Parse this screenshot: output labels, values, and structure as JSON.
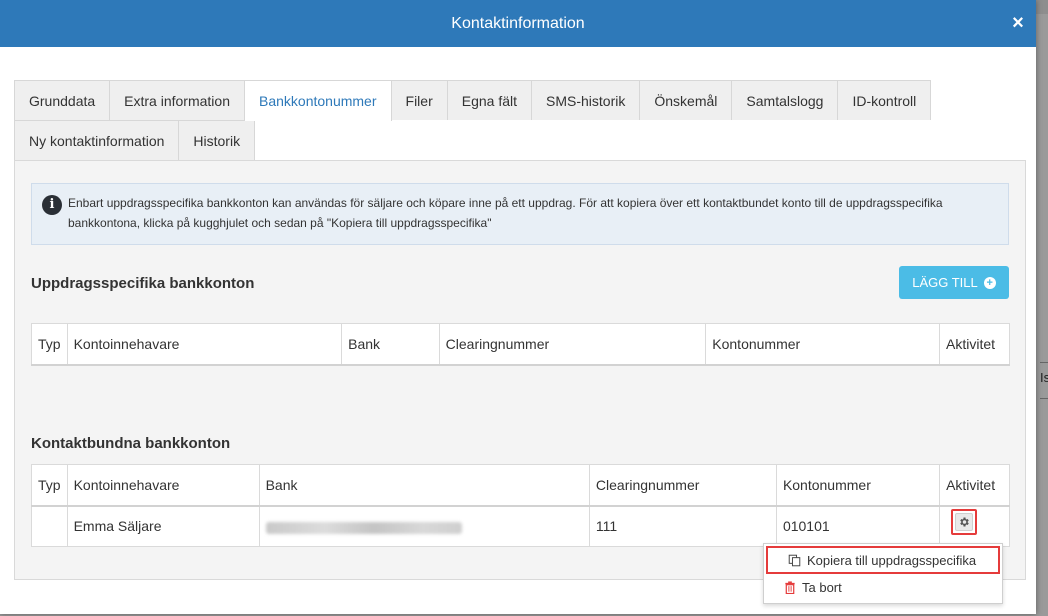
{
  "modal": {
    "title": "Kontaktinformation",
    "close_label": "×"
  },
  "tabs": {
    "row1": [
      "Grunddata",
      "Extra information",
      "Bankkontonummer",
      "Filer",
      "Egna fält",
      "SMS-historik",
      "Önskemål",
      "Samtalslogg",
      "ID-kontroll"
    ],
    "row2": [
      "Ny kontaktinformation",
      "Historik"
    ],
    "active": "Bankkontonummer"
  },
  "info": {
    "text": "Enbart uppdragsspecifika bankkonton kan användas för säljare och köpare inne på ett uppdrag. För att kopiera över ett kontaktbundet konto till de uppdragsspecifika bankkontona, klicka på kugghjulet och sedan på \"Kopiera till uppdragsspecifika\""
  },
  "assignment_accounts": {
    "title": "Uppdragsspecifika bankkonton",
    "add_button": "LÄGG TILL",
    "columns": [
      "Typ",
      "Kontoinnehavare",
      "Bank",
      "Clearingnummer",
      "Kontonummer",
      "Aktivitet"
    ],
    "rows": []
  },
  "contact_accounts": {
    "title": "Kontaktbundna bankkonton",
    "columns": [
      "Typ",
      "Kontoinnehavare",
      "Bank",
      "Clearingnummer",
      "Kontonummer",
      "Aktivitet"
    ],
    "rows": [
      {
        "typ": "",
        "holder": "Emma Säljare",
        "bank": "",
        "clearing": "111",
        "account": "010101"
      }
    ]
  },
  "menu": {
    "copy_label": "Kopiera till uppdragsspecifika",
    "delete_label": "Ta bort"
  },
  "background": {
    "right_text": "Is"
  },
  "colors": {
    "header": "#2e79b9",
    "accent": "#4bbce6",
    "highlight": "#e53b3b",
    "danger": "#e53b3b"
  }
}
